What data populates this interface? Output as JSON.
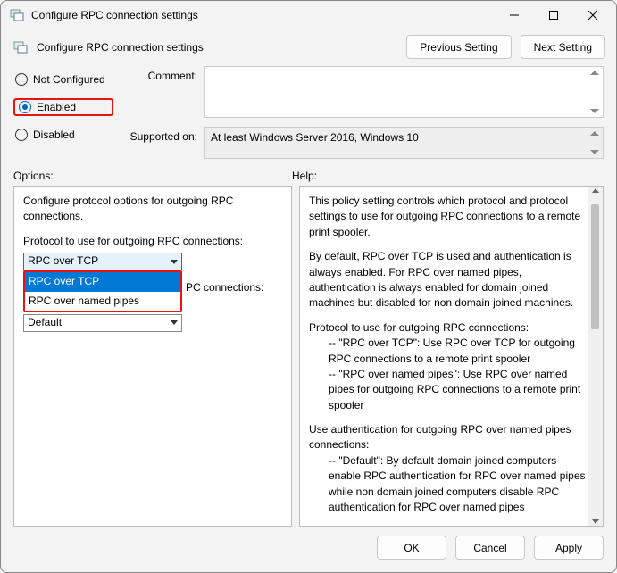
{
  "window": {
    "title": "Configure RPC connection settings"
  },
  "header": {
    "title": "Configure RPC connection settings",
    "prev": "Previous Setting",
    "next": "Next Setting"
  },
  "state": {
    "not_configured": "Not Configured",
    "enabled": "Enabled",
    "disabled": "Disabled"
  },
  "form": {
    "comment_label": "Comment:",
    "comment_value": "",
    "supported_label": "Supported on:",
    "supported_value": "At least Windows Server 2016, Windows 10"
  },
  "sections": {
    "options": "Options:",
    "help": "Help:"
  },
  "options": {
    "intro": "Configure protocol options for outgoing RPC connections.",
    "protocol_label": "Protocol to use for outgoing RPC connections:",
    "protocol_selected": "RPC over TCP",
    "protocol_items": {
      "a": "RPC over TCP",
      "b": "RPC over named pipes"
    },
    "auth_label_suffix": "PC connections:",
    "auth_selected": "Default"
  },
  "help": {
    "p1": "This policy setting controls which protocol and protocol settings to use for outgoing RPC connections to a remote print spooler.",
    "p2": "By default, RPC over TCP is used and authentication is always enabled. For RPC over named pipes, authentication is always enabled for domain joined machines but disabled for non domain joined machines.",
    "p3": "Protocol to use for outgoing RPC connections:",
    "p3a": "-- \"RPC over TCP\": Use RPC over TCP for outgoing RPC connections to a remote print spooler",
    "p3b": "-- \"RPC over named pipes\": Use RPC over named pipes for outgoing RPC connections to a remote print spooler",
    "p4": "Use authentication for outgoing RPC over named pipes connections:",
    "p4a": "-- \"Default\": By default domain joined computers enable RPC authentication for RPC over named pipes while non domain joined computers disable RPC authentication for RPC over named pipes"
  },
  "buttons": {
    "ok": "OK",
    "cancel": "Cancel",
    "apply": "Apply"
  }
}
